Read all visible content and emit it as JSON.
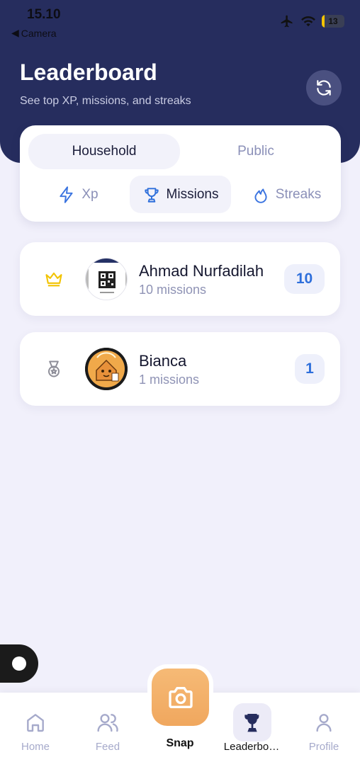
{
  "status": {
    "time": "15.10",
    "back_label": "Camera",
    "battery": "13",
    "battery_level": 0.13
  },
  "header": {
    "title": "Leaderboard",
    "subtitle": "See top XP, missions, and streaks",
    "refresh_icon": "refresh-icon"
  },
  "scope_tabs": [
    {
      "label": "Household",
      "active": true
    },
    {
      "label": "Public",
      "active": false
    }
  ],
  "metric_tabs": [
    {
      "label": "Xp",
      "icon": "lightning-icon",
      "active": false
    },
    {
      "label": "Missions",
      "icon": "trophy-icon",
      "active": true
    },
    {
      "label": "Streaks",
      "icon": "flame-icon",
      "active": false
    }
  ],
  "entries": [
    {
      "rank_icon": "crown-icon",
      "name": "Ahmad Nurfadilah",
      "subtitle": "10 missions",
      "score": "10"
    },
    {
      "rank_icon": "medal-icon",
      "name": "Bianca",
      "subtitle": "1 missions",
      "score": "1"
    }
  ],
  "tabbar": {
    "items": [
      {
        "label": "Home",
        "icon": "home-icon",
        "active": false
      },
      {
        "label": "Feed",
        "icon": "users-icon",
        "active": false
      },
      {
        "label": "Snap",
        "icon": "camera-icon",
        "active": false
      },
      {
        "label": "Leaderbo…",
        "icon": "trophy-icon",
        "active": true
      },
      {
        "label": "Profile",
        "icon": "user-icon",
        "active": false
      }
    ]
  },
  "colors": {
    "header": "#262d5e",
    "accent_blue": "#2e6fdb",
    "snap_orange": "#f0a75e",
    "crown_gold": "#f2c300"
  }
}
